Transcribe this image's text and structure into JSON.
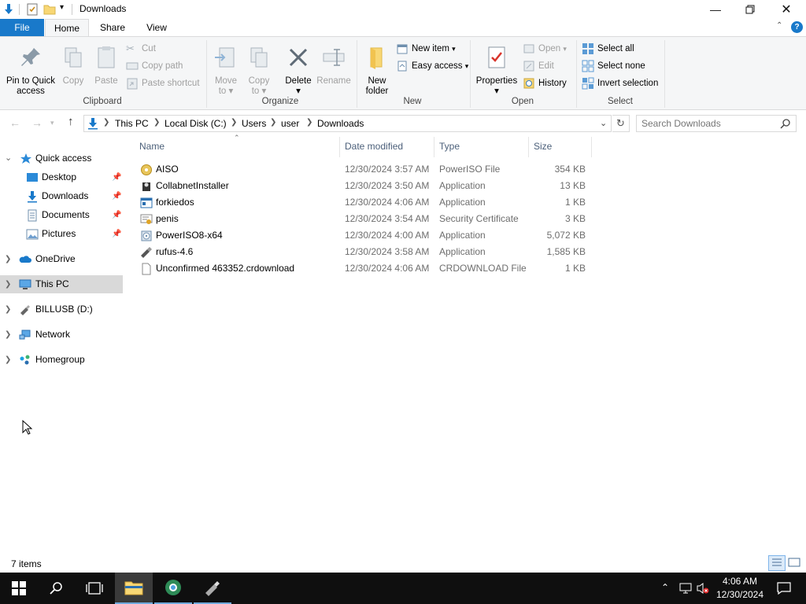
{
  "window": {
    "title": "Downloads"
  },
  "ribbon_tabs": [
    "File",
    "Home",
    "Share",
    "View"
  ],
  "ribbon": {
    "clipboard": {
      "pin_label": "Pin to Quick access",
      "copy_label": "Copy",
      "paste_label": "Paste",
      "cut_label": "Cut",
      "copy_path_label": "Copy path",
      "paste_shortcut_label": "Paste shortcut",
      "group_label": "Clipboard"
    },
    "organize": {
      "move_to_label": "Move to",
      "copy_to_label": "Copy to",
      "delete_label": "Delete",
      "rename_label": "Rename",
      "group_label": "Organize"
    },
    "new": {
      "new_folder_label": "New folder",
      "new_item_label": "New item",
      "easy_access_label": "Easy access",
      "group_label": "New"
    },
    "open": {
      "properties_label": "Properties",
      "open_label": "Open",
      "edit_label": "Edit",
      "history_label": "History",
      "group_label": "Open"
    },
    "select": {
      "select_all_label": "Select all",
      "select_none_label": "Select none",
      "invert_selection_label": "Invert selection",
      "group_label": "Select"
    }
  },
  "address": {
    "crumbs": [
      "This PC",
      "Local Disk (C:)",
      "Users",
      "user",
      "Downloads"
    ],
    "search_placeholder": "Search Downloads"
  },
  "navpane": {
    "quick_access": "Quick access",
    "qa_items": [
      "Desktop",
      "Downloads",
      "Documents",
      "Pictures"
    ],
    "onedrive": "OneDrive",
    "this_pc": "This PC",
    "billusb": "BILLUSB (D:)",
    "network": "Network",
    "homegroup": "Homegroup"
  },
  "columns": {
    "name": "Name",
    "date": "Date modified",
    "type": "Type",
    "size": "Size"
  },
  "files": [
    {
      "name": "AISO",
      "date": "12/30/2024 3:57 AM",
      "type": "PowerISO File",
      "size": "354 KB",
      "icon": "poweriso-file-icon"
    },
    {
      "name": "CollabnetInstaller",
      "date": "12/30/2024 3:50 AM",
      "type": "Application",
      "size": "13 KB",
      "icon": "installer-app-icon"
    },
    {
      "name": "forkiedos",
      "date": "12/30/2024 4:06 AM",
      "type": "Application",
      "size": "1 KB",
      "icon": "window-app-icon"
    },
    {
      "name": "penis",
      "date": "12/30/2024 3:54 AM",
      "type": "Security Certificate",
      "size": "3 KB",
      "icon": "certificate-icon"
    },
    {
      "name": "PowerISO8-x64",
      "date": "12/30/2024 4:00 AM",
      "type": "Application",
      "size": "5,072 KB",
      "icon": "poweriso-app-icon"
    },
    {
      "name": "rufus-4.6",
      "date": "12/30/2024 3:58 AM",
      "type": "Application",
      "size": "1,585 KB",
      "icon": "rufus-usb-icon"
    },
    {
      "name": "Unconfirmed 463352.crdownload",
      "date": "12/30/2024 4:06 AM",
      "type": "CRDOWNLOAD File",
      "size": "1 KB",
      "icon": "blank-file-icon"
    }
  ],
  "status": {
    "item_count": "7 items"
  },
  "taskbar": {
    "time": "4:06 AM",
    "date": "12/30/2024"
  },
  "colors": {
    "accent": "#1979ca",
    "ribbon_bg": "#f5f6f7",
    "selection": "#d9d9d9",
    "taskbar": "#0f0f0f",
    "header_text": "#4c607a"
  }
}
